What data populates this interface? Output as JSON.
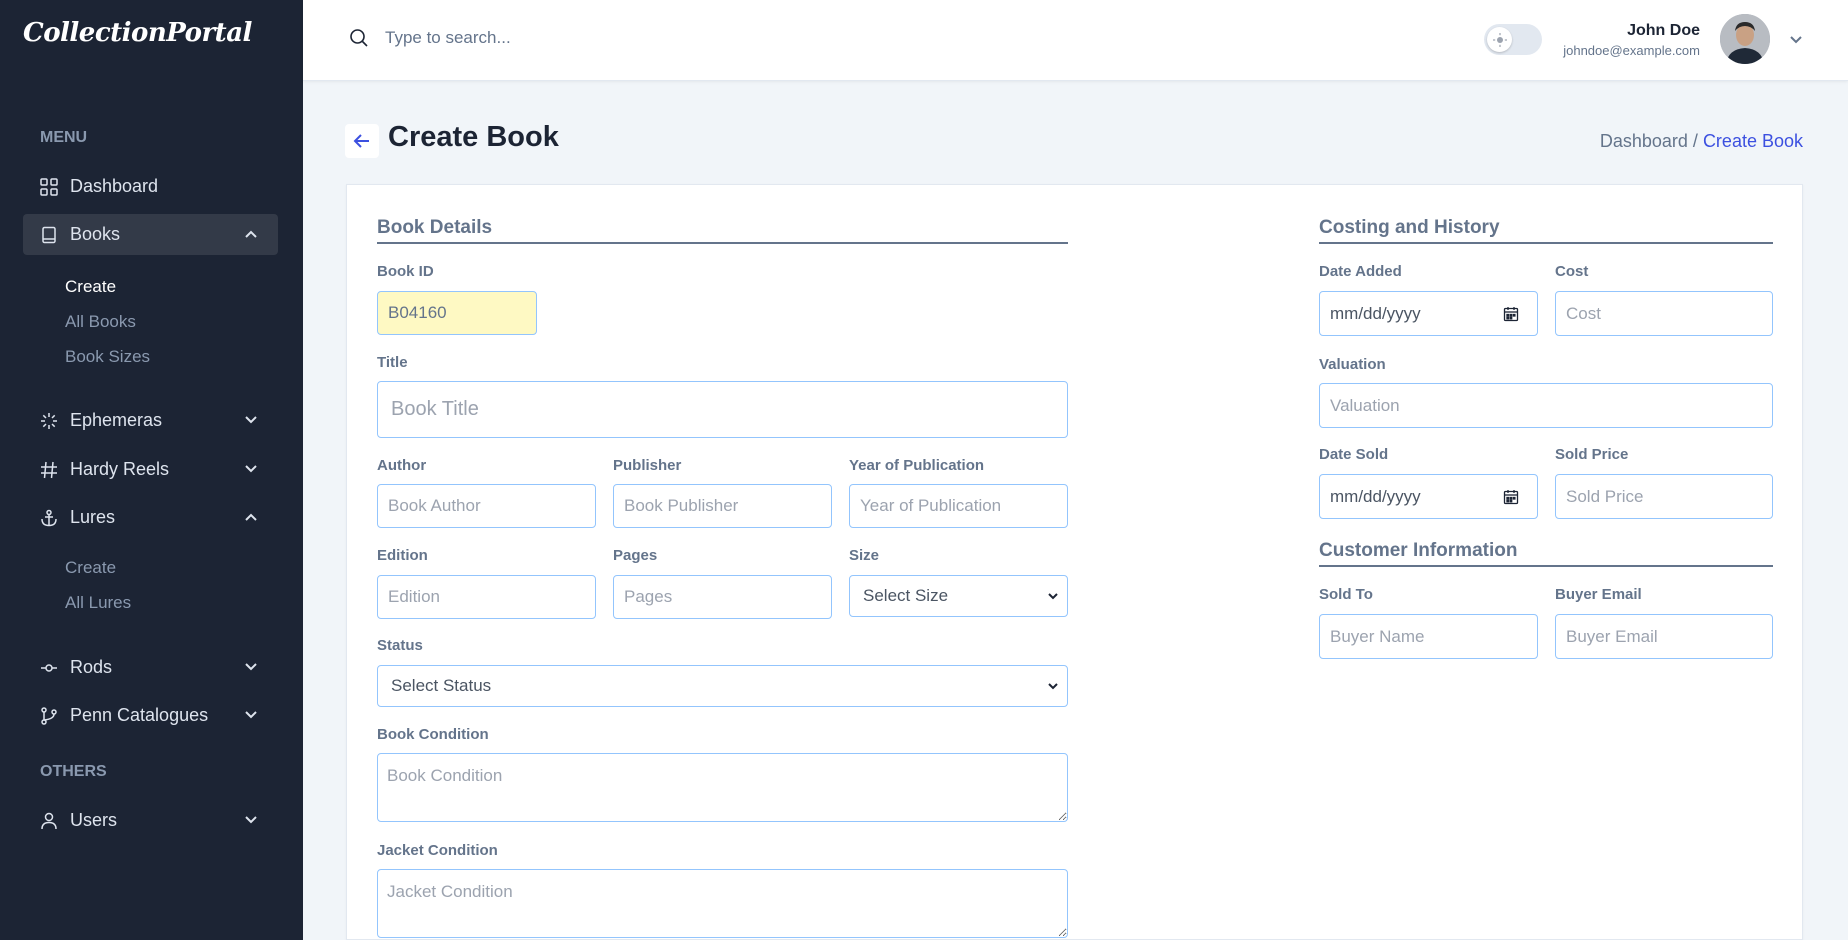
{
  "app": {
    "logo": "CollectionPortal"
  },
  "sidebar": {
    "menu_heading": "MENU",
    "others_heading": "OTHERS",
    "items": [
      {
        "label": "Dashboard",
        "icon": "dashboard-grid-icon"
      },
      {
        "label": "Books",
        "icon": "book-icon",
        "expanded": true
      },
      {
        "label": "Ephemeras",
        "icon": "sparkle-icon"
      },
      {
        "label": "Hardy Reels",
        "icon": "hash-icon"
      },
      {
        "label": "Lures",
        "icon": "anchor-icon",
        "expanded": true
      },
      {
        "label": "Rods",
        "icon": "rod-icon"
      },
      {
        "label": "Penn Catalogues",
        "icon": "branch-icon"
      },
      {
        "label": "Users",
        "icon": "user-icon"
      }
    ],
    "books_sub": [
      "Create",
      "All Books",
      "Book Sizes"
    ],
    "lures_sub": [
      "Create",
      "All Lures"
    ]
  },
  "header": {
    "search_placeholder": "Type to search...",
    "user_name": "John Doe",
    "user_email": "johndoe@example.com"
  },
  "page": {
    "title": "Create Book",
    "breadcrumb_parent": "Dashboard /",
    "breadcrumb_current": "Create Book"
  },
  "form": {
    "book_details_title": "Book Details",
    "book_id_label": "Book ID",
    "book_id_value": "B04160",
    "title_label": "Title",
    "title_placeholder": "Book Title",
    "author_label": "Author",
    "author_placeholder": "Book Author",
    "publisher_label": "Publisher",
    "publisher_placeholder": "Book Publisher",
    "year_label": "Year of Publication",
    "year_placeholder": "Year of Publication",
    "edition_label": "Edition",
    "edition_placeholder": "Edition",
    "pages_label": "Pages",
    "pages_placeholder": "Pages",
    "size_label": "Size",
    "size_selected": "Select Size",
    "status_label": "Status",
    "status_selected": "Select Status",
    "condition_label": "Book Condition",
    "condition_placeholder": "Book Condition",
    "jacket_label": "Jacket Condition",
    "jacket_placeholder": "Jacket Condition",
    "costing_title": "Costing and History",
    "date_added_label": "Date Added",
    "date_added_placeholder": "mm/dd/yyyy",
    "cost_label": "Cost",
    "cost_placeholder": "Cost",
    "valuation_label": "Valuation",
    "valuation_placeholder": "Valuation",
    "date_sold_label": "Date Sold",
    "date_sold_placeholder": "mm/dd/yyyy",
    "sold_price_label": "Sold Price",
    "sold_price_placeholder": "Sold Price",
    "customer_title": "Customer Information",
    "sold_to_label": "Sold To",
    "sold_to_placeholder": "Buyer Name",
    "buyer_email_label": "Buyer Email",
    "buyer_email_placeholder": "Buyer Email"
  },
  "colors": {
    "sidebar_bg": "#1c2434",
    "accent": "#3c50e0",
    "input_border": "#93c5fd",
    "highlight_bg": "#fef9c3"
  }
}
